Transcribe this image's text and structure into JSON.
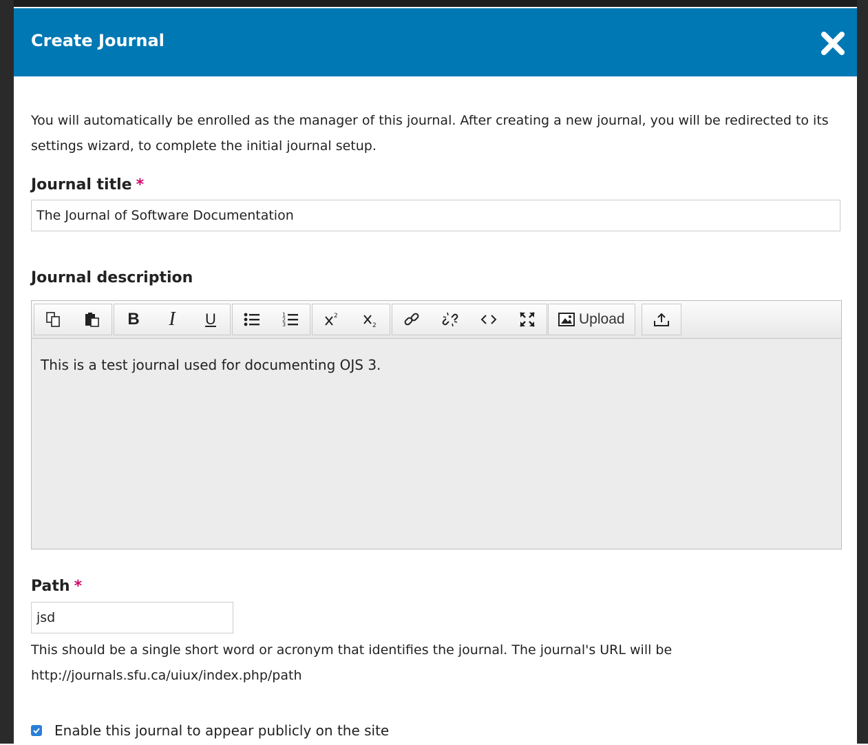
{
  "modal": {
    "title": "Create Journal",
    "close_icon": "close-icon",
    "header_color": "#0078b4"
  },
  "intro_text": "You will automatically be enrolled as the manager of this journal. After creating a new journal, you will be redirected to its settings wizard, to complete the initial journal setup.",
  "journal_title": {
    "label": "Journal title",
    "required_mark": "*",
    "value": "The Journal of Software Documentation"
  },
  "journal_description": {
    "label": "Journal description",
    "toolbar": {
      "icons": [
        "copy-icon",
        "paste-icon",
        "bold-icon",
        "italic-icon",
        "underline-icon",
        "bullet-list-icon",
        "numbered-list-icon",
        "superscript-icon",
        "subscript-icon",
        "link-icon",
        "unlink-icon",
        "code-icon",
        "fullscreen-icon",
        "image-icon",
        "upload-icon"
      ],
      "bold": "B",
      "italic": "I",
      "underline": "U",
      "upload_label": "Upload"
    },
    "value": "This is a test journal used for documenting OJS 3."
  },
  "path": {
    "label": "Path",
    "required_mark": "*",
    "value": "jsd",
    "help_line1": "This should be a single short word or acronym that identifies the journal. The journal's URL will be",
    "help_line2": "http://journals.sfu.ca/uiux/index.php/path"
  },
  "public_checkbox": {
    "label": "Enable this journal to appear publicly on the site",
    "checked": true
  },
  "colors": {
    "required": "#d00a6c",
    "checkbox": "#2b7fd6"
  }
}
